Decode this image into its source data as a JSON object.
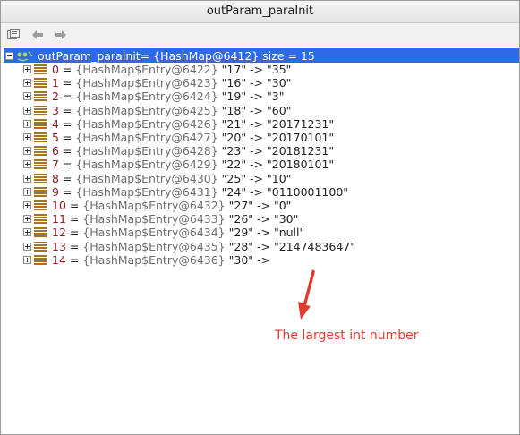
{
  "window": {
    "title": "outParam_paraInit"
  },
  "toolbar": {
    "icons": [
      "variables-icon",
      "back-arrow-icon",
      "forward-arrow-icon"
    ]
  },
  "tree": {
    "root": {
      "name": "outParam_paraInit",
      "summary": " = {HashMap@6412}  size = 15"
    },
    "entries": [
      {
        "index": "0",
        "type": "{HashMap$Entry@6422}",
        "kv": "\"17\" -> \"35\""
      },
      {
        "index": "1",
        "type": "{HashMap$Entry@6423}",
        "kv": "\"16\" -> \"30\""
      },
      {
        "index": "2",
        "type": "{HashMap$Entry@6424}",
        "kv": "\"19\" -> \"3\""
      },
      {
        "index": "3",
        "type": "{HashMap$Entry@6425}",
        "kv": "\"18\" -> \"60\""
      },
      {
        "index": "4",
        "type": "{HashMap$Entry@6426}",
        "kv": "\"21\" -> \"20171231\""
      },
      {
        "index": "5",
        "type": "{HashMap$Entry@6427}",
        "kv": "\"20\" -> \"20170101\""
      },
      {
        "index": "6",
        "type": "{HashMap$Entry@6428}",
        "kv": "\"23\" -> \"20181231\""
      },
      {
        "index": "7",
        "type": "{HashMap$Entry@6429}",
        "kv": "\"22\" -> \"20180101\""
      },
      {
        "index": "8",
        "type": "{HashMap$Entry@6430}",
        "kv": "\"25\" -> \"10\""
      },
      {
        "index": "9",
        "type": "{HashMap$Entry@6431}",
        "kv": "\"24\" -> \"0110001100\""
      },
      {
        "index": "10",
        "type": "{HashMap$Entry@6432}",
        "kv": "\"27\" -> \"0\""
      },
      {
        "index": "11",
        "type": "{HashMap$Entry@6433}",
        "kv": "\"26\" -> \"30\""
      },
      {
        "index": "12",
        "type": "{HashMap$Entry@6434}",
        "kv": "\"29\" -> \"null\""
      },
      {
        "index": "13",
        "type": "{HashMap$Entry@6435}",
        "kv": "\"28\" -> \"2147483647\""
      },
      {
        "index": "14",
        "type": "{HashMap$Entry@6436}",
        "kv": "\"30\" ->"
      }
    ]
  },
  "annotation": {
    "text": "The largest int number",
    "color": "#e33a2e"
  },
  "colors": {
    "selection": "#2d6ae8",
    "entry_icon": "#a8741c",
    "index": "#8b1a1a"
  }
}
